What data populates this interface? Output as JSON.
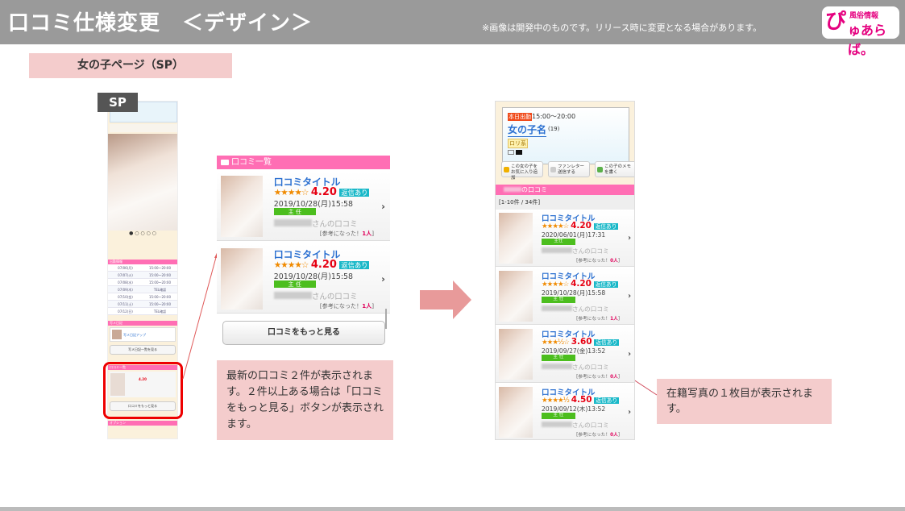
{
  "header": {
    "title": "口コミ仕様変更　＜デザイン＞",
    "note": "※画像は開発中のものです。リリース時に変更となる場合があります。",
    "logo_big": "ぴ",
    "logo_small": "風俗情報",
    "logo_main": "ゅあらば。"
  },
  "section_label": "女の子ページ（SP）",
  "sp_badge": "SP",
  "sp_thumb": {
    "schedule_header": "出勤情報",
    "schedule": [
      [
        "07/06(月)",
        "15:00～20:00"
      ],
      [
        "07/07(火)",
        "15:00～20:00"
      ],
      [
        "07/08(水)",
        "15:00～20:00"
      ],
      [
        "07/09(木)",
        "TEL確認"
      ],
      [
        "07/10(金)",
        "15:00～20:00"
      ],
      [
        "07/11(土)",
        "15:00～20:00"
      ],
      [
        "07/12(日)",
        "TEL確認"
      ]
    ],
    "diary_header": "写メ日記",
    "diary_title": "写メ日記アップ",
    "diary_button": "写メ日記一覧を見る",
    "review_header": "口コミ一覧",
    "review_score": "4.20",
    "more_button": "口コミをもっと見る",
    "tags_header": "オプション"
  },
  "middle": {
    "header": "口コミ一覧",
    "reviews": [
      {
        "title": "口コミタイトル",
        "stars": "★★★★☆",
        "score": "4.20",
        "reply": "返信あり",
        "date": "2019/10/28(月)15:58",
        "badge": "主 任",
        "name_suffix": "さんの口コミ",
        "helpful_label": "[参考になった！",
        "helpful_count": "1人",
        "helpful_end": "]"
      },
      {
        "title": "口コミタイトル",
        "stars": "★★★★☆",
        "score": "4.20",
        "reply": "返信あり",
        "date": "2019/10/28(月)15:58",
        "badge": "主 任",
        "name_suffix": "さんの口コミ",
        "helpful_label": "[参考になった！",
        "helpful_count": "1人",
        "helpful_end": "]"
      }
    ],
    "more_button": "口コミをもっと見る"
  },
  "note1": "最新の口コミ２件が表示されます。２件以上ある場合は「口コミをもっと見る」ボタンが表示されます。",
  "right": {
    "today_label": "本日出勤",
    "time": "15:00～20:00",
    "girl_name": "女の子名",
    "age": "(19)",
    "type_tag": "ロリ系",
    "buttons": [
      "この女の子をお気に入り追加",
      "ファンレター送信する",
      "この子のメモを書く"
    ],
    "review_header_suffix": "の口コミ",
    "count": "[1-10件 / 34件]",
    "reviews": [
      {
        "title": "口コミタイトル",
        "stars": "★★★★☆",
        "score": "4.20",
        "reply": "返信あり",
        "date": "2020/06/01(月)17:31",
        "badge": "主任",
        "name_suffix": "さんの口コミ",
        "helpful_label": "[参考になった！",
        "helpful_count": "0人",
        "helpful_end": "]"
      },
      {
        "title": "口コミタイトル",
        "stars": "★★★★☆",
        "score": "4.20",
        "reply": "返信あり",
        "date": "2019/10/28(月)15:58",
        "badge": "主 任",
        "name_suffix": "さんの口コミ",
        "helpful_label": "[参考になった！",
        "helpful_count": "1人",
        "helpful_end": "]"
      },
      {
        "title": "口コミタイトル",
        "stars": "★★★½☆",
        "score": "3.60",
        "reply": "返信あり",
        "date": "2019/09/27(金)13:52",
        "badge": "主 任",
        "name_suffix": "さんの口コミ",
        "helpful_label": "[参考になった！",
        "helpful_count": "0人",
        "helpful_end": "]"
      },
      {
        "title": "口コミタイトル",
        "stars": "★★★★½",
        "score": "4.50",
        "reply": "返信あり",
        "date": "2019/09/12(木)13:52",
        "badge": "主 任",
        "name_suffix": "さんの口コミ",
        "helpful_label": "[参考になった！",
        "helpful_count": "0人",
        "helpful_end": "]"
      }
    ]
  },
  "note2": "在籍写真の１枚目が表示されます。",
  "colors": {
    "header": "#9a9a9a",
    "pink": "#ff6eb4",
    "note": "#f4cccc",
    "arrow": "#e89a9a"
  }
}
